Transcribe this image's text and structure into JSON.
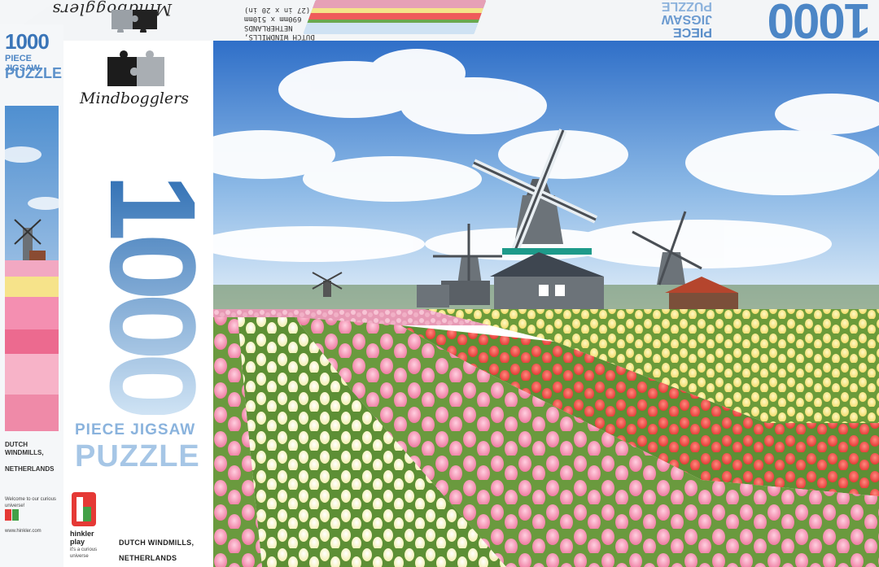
{
  "brand": {
    "name": "Mindbogglers"
  },
  "product": {
    "piece_count": "1000",
    "line1": "PIECE JIGSAW",
    "line2": "PUZZLE",
    "scene_title": "DUTCH WINDMILLS,",
    "scene_location": "NETHERLANDS"
  },
  "side": {
    "piece_count": "1000",
    "line1": "PIECE JIGSAW",
    "line2": "PUZZLE",
    "scene_title": "DUTCH WINDMILLS,",
    "scene_location": "NETHERLANDS",
    "welcome_text": "Welcome to our curious universe!",
    "website": "www.hinkler.com"
  },
  "top_flap": {
    "brand": "Mindbogglers",
    "caption_line1": "DUTCH WINDMILLS,",
    "caption_line2": "NETHERLANDS",
    "size_line1": "690mm x 510mm",
    "size_line2": "(27 in x 20 in)",
    "piece_count": "1000",
    "line1": "PIECE",
    "line2": "JIGSAW",
    "line3": "PUZZLE"
  },
  "publisher": {
    "name_line1": "hinkler",
    "name_line2": "play",
    "tagline_line1": "it's a curious",
    "tagline_line2": "universe"
  },
  "colors": {
    "title_blue_top": "#2f6fb4",
    "title_blue_bottom": "#cfe3f4",
    "text_dark": "#2a2a2a",
    "hinkler_red": "#e53935",
    "hinkler_green": "#43a047",
    "hinkler_orange": "#fb8c00",
    "hinkler_blue": "#1e88e5"
  }
}
